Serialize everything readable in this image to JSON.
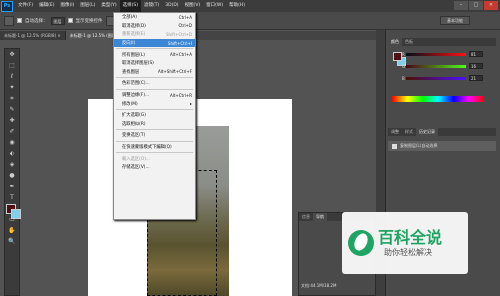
{
  "app": {
    "logo": "Ps"
  },
  "menubar": {
    "items": [
      "文件(F)",
      "编辑(E)",
      "图像(I)",
      "图层(L)",
      "类型(Y)",
      "选择(S)",
      "滤镜(T)",
      "3D(D)",
      "视图(V)",
      "窗口(W)",
      "帮助(H)"
    ],
    "active": "选择(S)"
  },
  "window_controls": {
    "minimize": "–",
    "maximize": "□",
    "close": "✕"
  },
  "options": {
    "auto_select_label": "自动选择：",
    "auto_select_value": "图层",
    "show_transform_label": "显示变换控件",
    "workspace_label": "基本功能"
  },
  "tabs": [
    {
      "label": "未标题-1 @ 12.5% (RGB/8) ×",
      "active": false
    },
    {
      "label": "未标题-1 @ 12.5% (图层 0, RGB/8) ×",
      "active": true
    }
  ],
  "select_menu": {
    "items": [
      {
        "label": "全部(A)",
        "shortcut": "Ctrl+A",
        "state": "normal"
      },
      {
        "label": "取消选择(D)",
        "shortcut": "Ctrl+D",
        "state": "normal"
      },
      {
        "label": "重新选择(E)",
        "shortcut": "Shift+Ctrl+D",
        "state": "disabled"
      },
      {
        "label": "反向(I)",
        "shortcut": "Shift+Ctrl+I",
        "state": "highlighted"
      },
      {
        "sep": true
      },
      {
        "label": "所有图层(L)",
        "shortcut": "Alt+Ctrl+A",
        "state": "normal"
      },
      {
        "label": "取消选择图层(S)",
        "shortcut": "",
        "state": "normal"
      },
      {
        "label": "查找图层",
        "shortcut": "Alt+Shift+Ctrl+F",
        "state": "normal"
      },
      {
        "sep": true
      },
      {
        "label": "色彩范围(C)...",
        "shortcut": "",
        "state": "normal"
      },
      {
        "sep": true
      },
      {
        "label": "调整边缘(F)...",
        "shortcut": "Alt+Ctrl+R",
        "state": "normal"
      },
      {
        "label": "修改(M)",
        "shortcut": "▸",
        "state": "normal"
      },
      {
        "sep": true
      },
      {
        "label": "扩大选取(G)",
        "shortcut": "",
        "state": "normal"
      },
      {
        "label": "选取相似(R)",
        "shortcut": "",
        "state": "normal"
      },
      {
        "sep": true
      },
      {
        "label": "变换选区(T)",
        "shortcut": "",
        "state": "normal"
      },
      {
        "sep": true
      },
      {
        "label": "在快速蒙版模式下编辑(Q)",
        "shortcut": "",
        "state": "normal"
      },
      {
        "sep": true
      },
      {
        "label": "载入选区(O)...",
        "shortcut": "",
        "state": "disabled"
      },
      {
        "label": "存储选区(V)...",
        "shortcut": "",
        "state": "normal"
      }
    ]
  },
  "tools": [
    "✥",
    "⬚",
    "ℓ",
    "✦",
    "⌗",
    "✎",
    "✚",
    "✐",
    "◉",
    "⬖",
    "◈",
    "●",
    "✒",
    "T",
    "↖",
    "▭",
    "✋",
    "🔍"
  ],
  "colors": {
    "foreground": "#4d1015",
    "background": "#7fd0e8"
  },
  "color_panel": {
    "tabs": [
      "颜色",
      "色板"
    ],
    "channels": [
      {
        "label": "R",
        "value": "81"
      },
      {
        "label": "G",
        "value": "16"
      },
      {
        "label": "B",
        "value": "21"
      }
    ]
  },
  "history_panel": {
    "tabs": [
      "调整",
      "样式",
      "历史记录"
    ],
    "item": "复制图层(L)自动选择"
  },
  "nav_panel": {
    "tabs": [
      "信息",
      "导航"
    ],
    "readout": "文档:44.1M/38.2M"
  },
  "watermark": {
    "title": "百科全说",
    "subtitle": "助你轻松解决"
  }
}
